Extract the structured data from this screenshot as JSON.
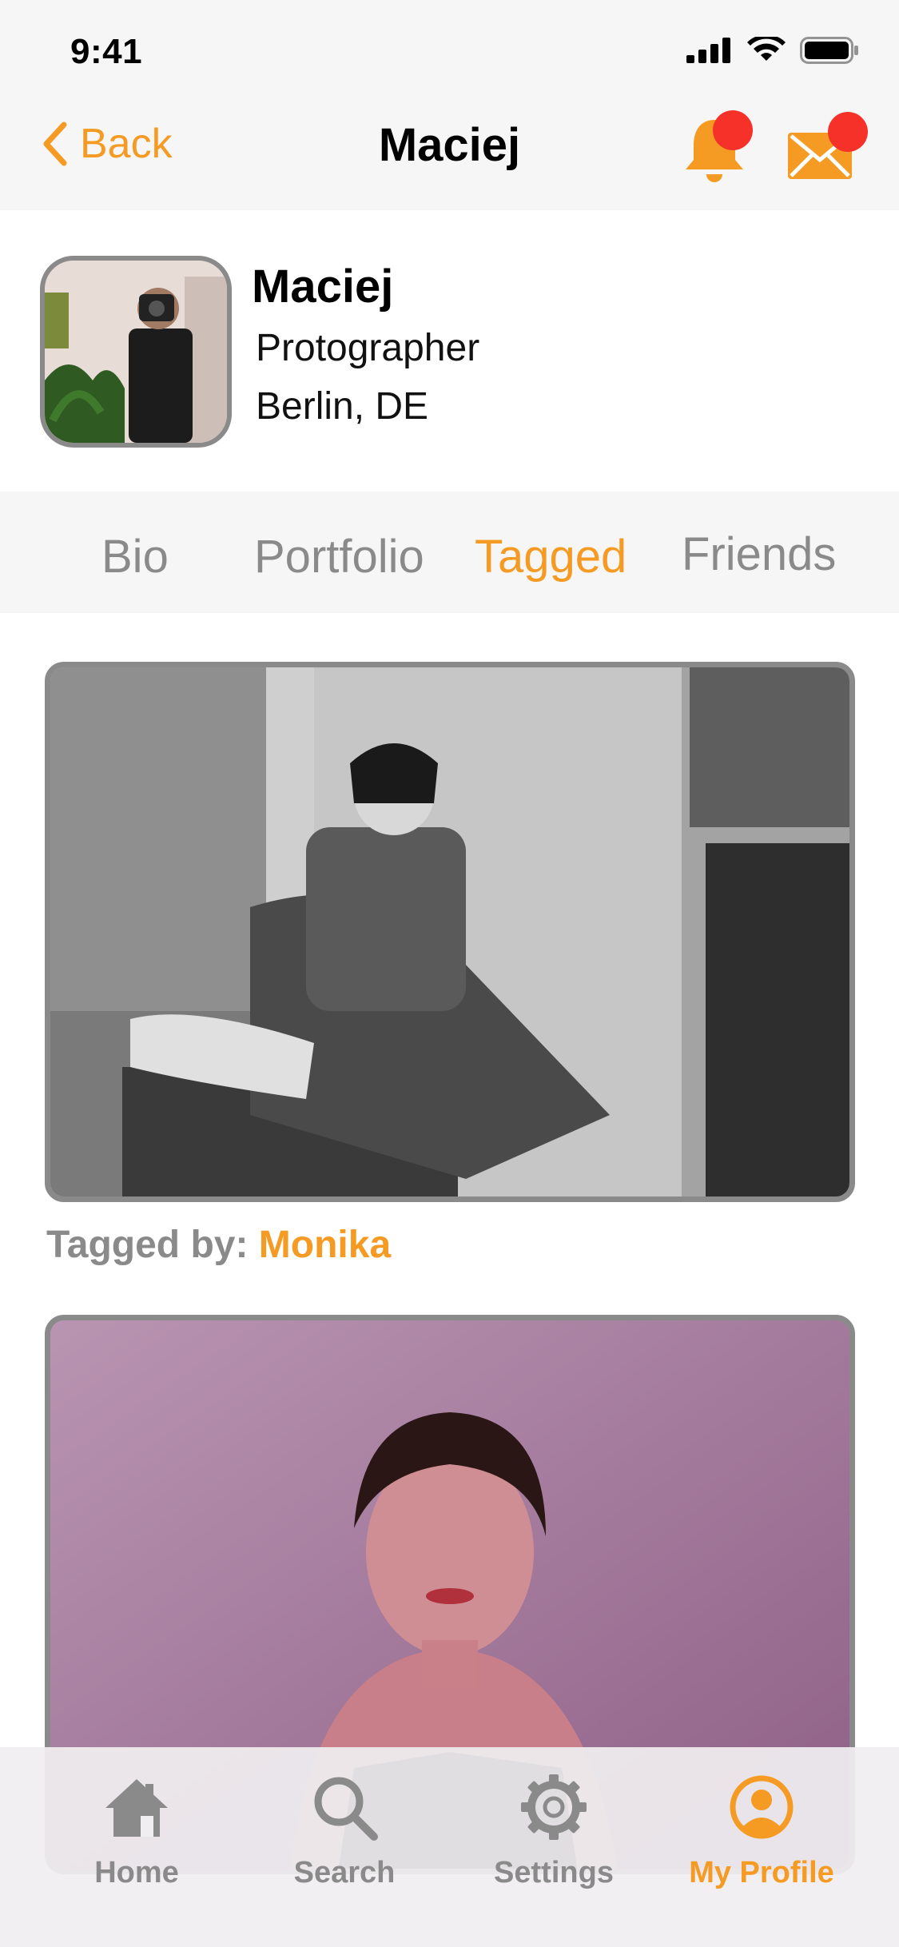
{
  "status_bar": {
    "time": "9:41"
  },
  "nav": {
    "back_label": "Back",
    "title": "Maciej",
    "icons": [
      "bell-icon",
      "mail-icon"
    ],
    "badge_color": "#f5312a"
  },
  "profile": {
    "name": "Maciej",
    "role": "Protographer",
    "location": "Berlin, DE"
  },
  "tabs": [
    {
      "label": "Bio",
      "active": false
    },
    {
      "label": "Portfolio",
      "active": false
    },
    {
      "label": "Tagged",
      "active": true
    },
    {
      "label": "Friends",
      "active": false
    }
  ],
  "feed": [
    {
      "tagged_by_label": "Tagged by:",
      "tagged_by_name": "Monika"
    }
  ],
  "tabbar": [
    {
      "label": "Home",
      "icon": "home-icon",
      "active": false
    },
    {
      "label": "Search",
      "icon": "search-icon",
      "active": false
    },
    {
      "label": "Settings",
      "icon": "gear-icon",
      "active": false
    },
    {
      "label": "My Profile",
      "icon": "profile-icon",
      "active": true
    }
  ],
  "colors": {
    "accent": "#f59a23",
    "muted": "#8a8a8a",
    "header_bg": "#f6f6f6"
  }
}
